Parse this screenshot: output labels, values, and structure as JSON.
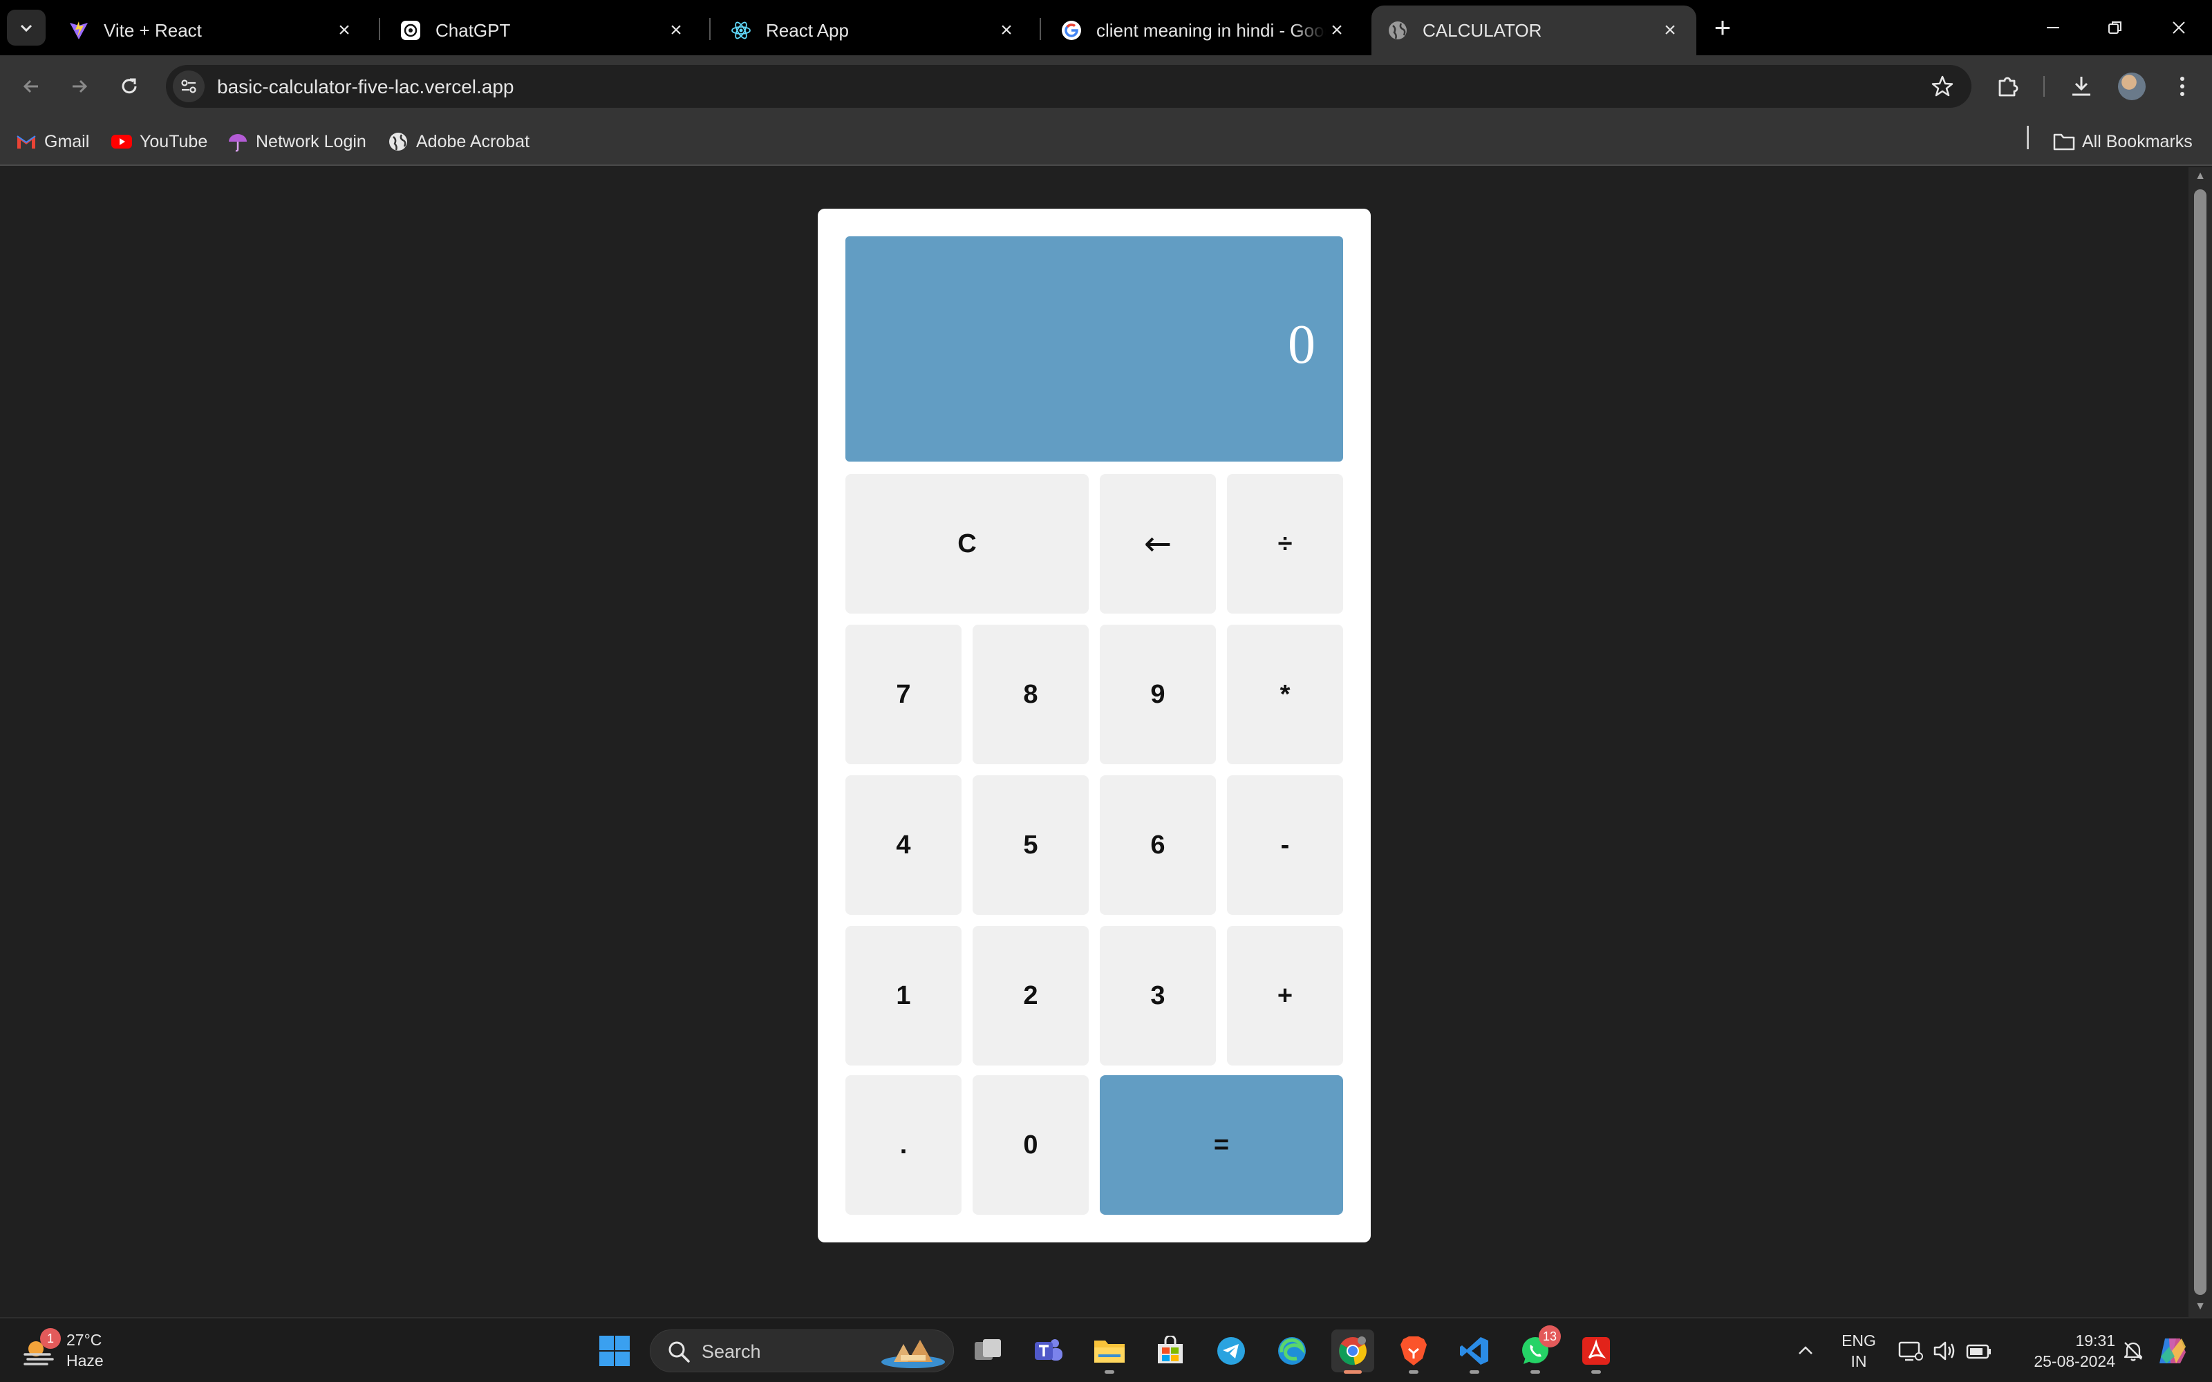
{
  "browser": {
    "tabs": [
      {
        "title": "Vite + React",
        "icon": "vite-icon",
        "active": false
      },
      {
        "title": "ChatGPT",
        "icon": "chatgpt-icon",
        "active": false
      },
      {
        "title": "React App",
        "icon": "react-icon",
        "active": false
      },
      {
        "title": "client meaning in hindi - Google",
        "icon": "google-icon",
        "active": false
      },
      {
        "title": "CALCULATOR",
        "icon": "globe-icon",
        "active": true
      }
    ],
    "url": "basic-calculator-five-lac.vercel.app",
    "bookmarks": [
      {
        "label": "Gmail",
        "icon": "gmail-icon"
      },
      {
        "label": "YouTube",
        "icon": "youtube-icon"
      },
      {
        "label": "Network Login",
        "icon": "umbrella-icon"
      },
      {
        "label": "Adobe Acrobat",
        "icon": "globe-icon"
      }
    ],
    "all_bookmarks": "All Bookmarks"
  },
  "calculator": {
    "display": "0",
    "keys": {
      "clear": "C",
      "backspace": "←",
      "divide": "÷",
      "seven": "7",
      "eight": "8",
      "nine": "9",
      "multiply": "*",
      "four": "4",
      "five": "5",
      "six": "6",
      "minus": "-",
      "one": "1",
      "two": "2",
      "three": "3",
      "plus": "+",
      "dot": ".",
      "zero": "0",
      "equals": "="
    },
    "colors": {
      "accent": "#629dc3",
      "key_bg": "#f0f0f0",
      "card_bg": "#ffffff",
      "page_bg": "#202020"
    }
  },
  "taskbar": {
    "weather": {
      "temp": "27°C",
      "condition": "Haze",
      "badge": "1"
    },
    "search_placeholder": "Search",
    "whatsapp_badge": "13",
    "language": {
      "line1": "ENG",
      "line2": "IN"
    },
    "clock": {
      "time": "19:31",
      "date": "25-08-2024"
    }
  }
}
